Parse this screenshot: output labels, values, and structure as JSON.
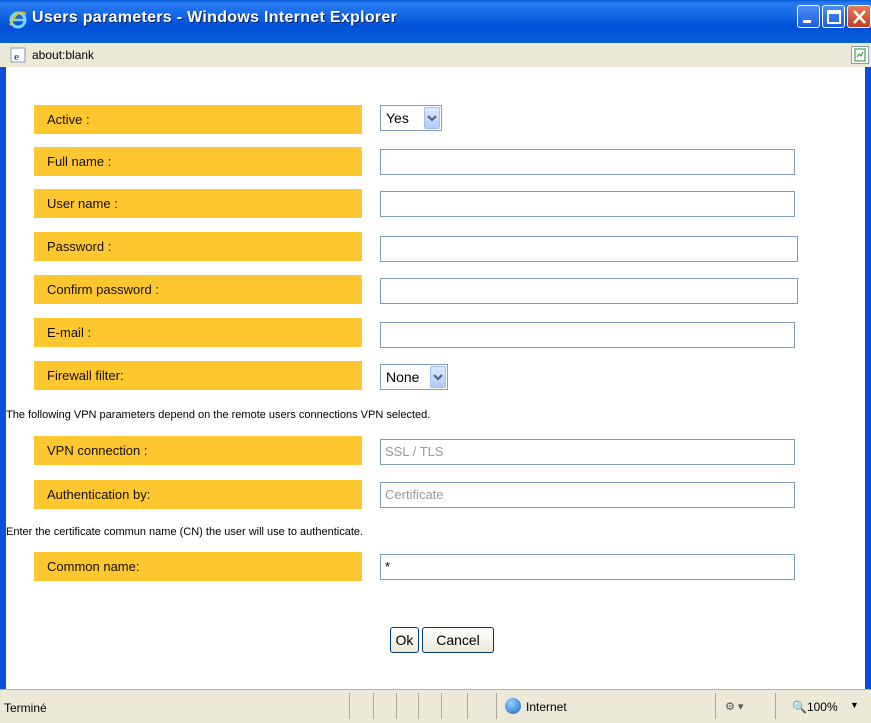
{
  "window": {
    "title": "Users parameters - Windows Internet Explorer",
    "address": "about:blank"
  },
  "form": {
    "active": {
      "label": "Active :",
      "value": "Yes"
    },
    "full_name": {
      "label": "Full name :",
      "value": ""
    },
    "user_name": {
      "label": "User name :",
      "value": ""
    },
    "password": {
      "label": "Password :",
      "value": ""
    },
    "confirm_password": {
      "label": "Confirm password :",
      "value": ""
    },
    "email": {
      "label": "E-mail :",
      "value": ""
    },
    "firewall_filter": {
      "label": "Firewall filter:",
      "value": "None"
    },
    "vpn_note": "The following VPN parameters depend on the remote users connections VPN selected.",
    "vpn_connection": {
      "label": "VPN connection :",
      "value": "SSL / TLS"
    },
    "authentication": {
      "label": "Authentication by:",
      "value": "Certificate"
    },
    "cn_note": "Enter the certificate commun name (CN) the user will use to authenticate.",
    "common_name": {
      "label": "Common name:",
      "value": "*"
    },
    "ok_label": "Ok",
    "cancel_label": "Cancel"
  },
  "status": {
    "text": "Terminé",
    "zone": "Internet",
    "zoom": "100%"
  },
  "colors": {
    "label_bg": "#fec62f",
    "titlebar": "#0a5fd8"
  }
}
